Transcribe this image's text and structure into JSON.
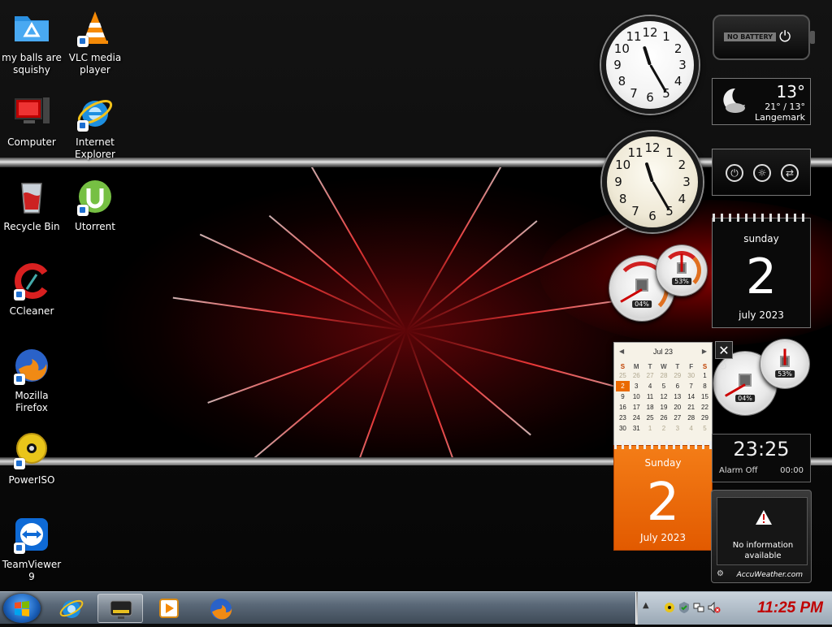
{
  "desktop_icons": [
    {
      "label": "my balls are squishy",
      "icon": "folder-icon"
    },
    {
      "label": "VLC media player",
      "icon": "vlc-icon"
    },
    {
      "label": "Computer",
      "icon": "computer-icon"
    },
    {
      "label": "Internet Explorer",
      "icon": "internet-explorer-icon"
    },
    {
      "label": "Recycle Bin",
      "icon": "recycle-bin-icon"
    },
    {
      "label": "Utorrent",
      "icon": "utorrent-icon"
    },
    {
      "label": "CCleaner",
      "icon": "ccleaner-icon"
    },
    {
      "label": "Mozilla Firefox",
      "icon": "firefox-icon"
    },
    {
      "label": "PowerISO",
      "icon": "poweriso-icon"
    },
    {
      "label": "TeamViewer 9",
      "icon": "teamviewer-icon"
    }
  ],
  "battery": {
    "text": "NO BATTERY"
  },
  "weather": {
    "temp": "13°",
    "range": "21° / 13°",
    "location": "Langemark",
    "icon": "moon-cloud-icon"
  },
  "clock_analog": {
    "hour": 11,
    "minute": 25
  },
  "controls": {
    "icons": [
      "power-icon",
      "brightness-icon",
      "switch-icon"
    ]
  },
  "date_gadget": {
    "day_name": "sunday",
    "day": "2",
    "month_year": "july 2023"
  },
  "cpu_meter_top": {
    "cpu": "04%",
    "ram": "53%"
  },
  "cpu_meter_bottom": {
    "cpu": "04%",
    "ram": "53%"
  },
  "calendar": {
    "month_label": "Jul 23",
    "weekdays": [
      "S",
      "M",
      "T",
      "W",
      "T",
      "F",
      "S"
    ],
    "weeks": [
      [
        "25",
        "26",
        "27",
        "28",
        "29",
        "30",
        "1"
      ],
      [
        "2",
        "3",
        "4",
        "5",
        "6",
        "7",
        "8"
      ],
      [
        "9",
        "10",
        "11",
        "12",
        "13",
        "14",
        "15"
      ],
      [
        "16",
        "17",
        "18",
        "19",
        "20",
        "21",
        "22"
      ],
      [
        "23",
        "24",
        "25",
        "26",
        "27",
        "28",
        "29"
      ],
      [
        "30",
        "31",
        "1",
        "2",
        "3",
        "4",
        "5"
      ]
    ],
    "selected_day": "2"
  },
  "orange_calendar": {
    "day_name": "Sunday",
    "day": "2",
    "month_year": "July 2023"
  },
  "digital_clock": {
    "time": "23:25",
    "alarm_label": "Alarm Off",
    "alarm_time": "00:00"
  },
  "accuweather": {
    "message": "No information available",
    "brand": "AccuWeather.com"
  },
  "taskbar": {
    "pinned": [
      "internet-explorer-icon",
      "active-window-icon",
      "media-player-icon",
      "firefox-icon"
    ],
    "clock": "11:25 PM"
  },
  "colors": {
    "accent_red": "#c00000",
    "orange": "#ea6a00"
  }
}
